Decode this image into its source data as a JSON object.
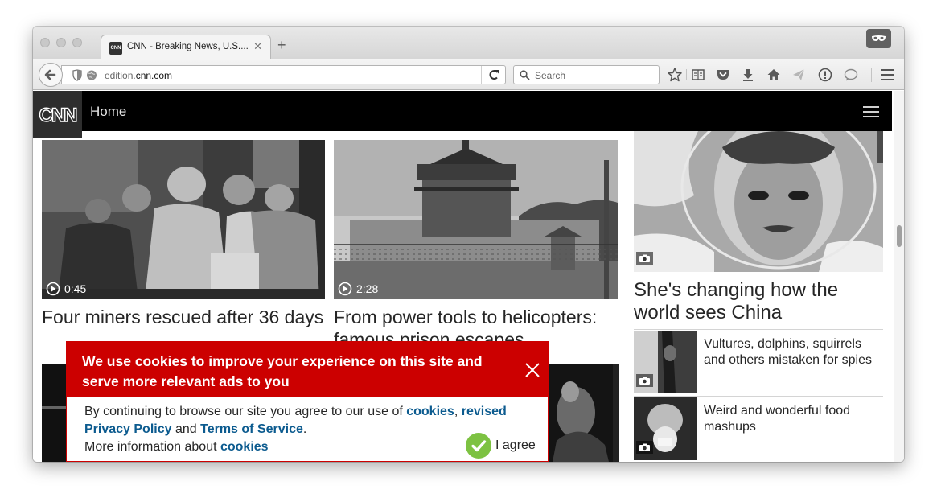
{
  "browser": {
    "tab_title": "CNN - Breaking News, U.S....",
    "tab_favicon_text": "CNN",
    "url_domain_prefix": "edition.",
    "url_domain_main": "cnn.com",
    "search_placeholder": "Search"
  },
  "site": {
    "nav_home": "Home"
  },
  "stories": [
    {
      "duration": "0:45",
      "headline": "Four miners rescued after 36 days"
    },
    {
      "duration": "2:28",
      "headline": "From power tools to helicopters: famous prison escapes"
    }
  ],
  "sidebar": {
    "feature_headline": "She's changing how the world sees China",
    "items": [
      {
        "headline": "Vultures, dolphins, squirrels and others mistaken for spies"
      },
      {
        "headline": "Weird and wonderful food mashups"
      }
    ]
  },
  "cookie_banner": {
    "title": "We use cookies to improve your experience on this site and serve more relevant ads to you",
    "text_1": "By continuing to browse our site you agree to our use of ",
    "link_cookies": "cookies",
    "sep_1": ", ",
    "link_revised_privacy": "revised Privacy Policy",
    "sep_2": " and ",
    "link_terms": "Terms of Service",
    "sep_3": ".",
    "text_2": "More information about ",
    "link_cookies_2": "cookies",
    "agree_label": "I agree"
  }
}
